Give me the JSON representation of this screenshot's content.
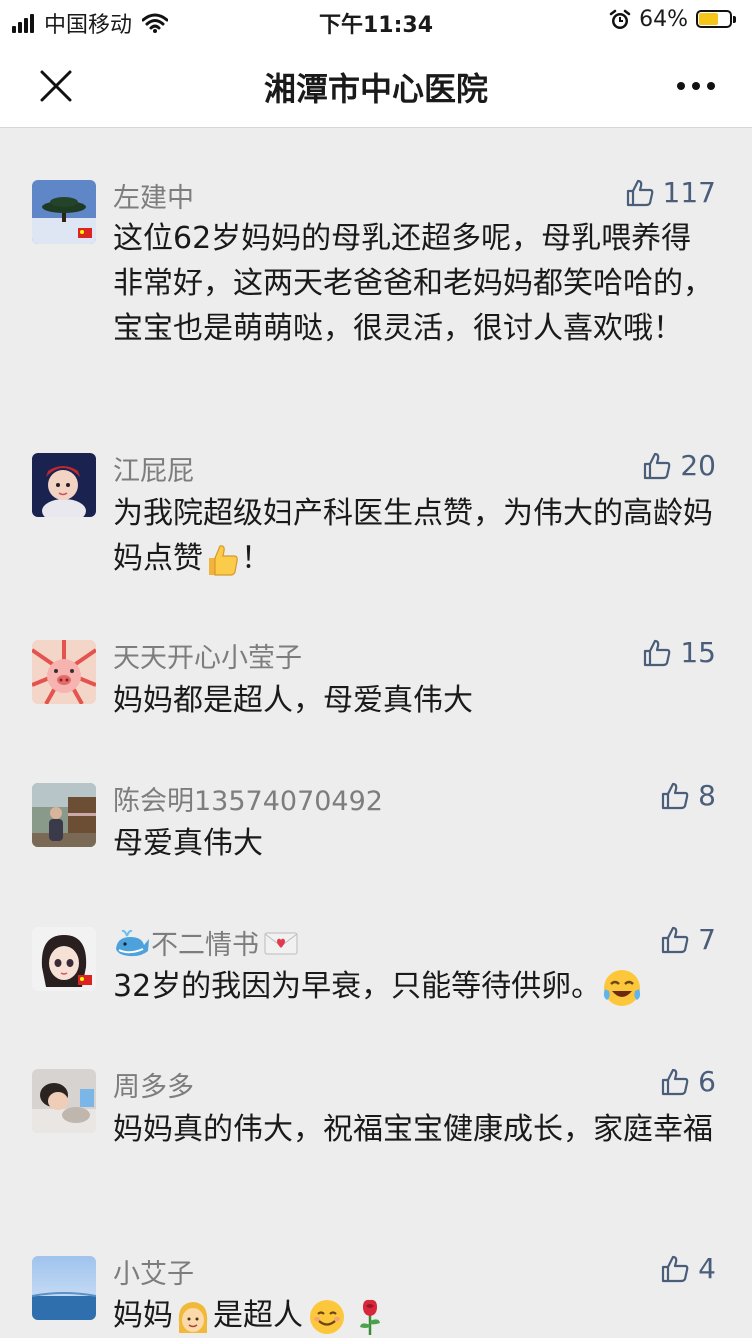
{
  "status_bar": {
    "carrier": "中国移动",
    "time": "下午11:34",
    "battery_percent": "64%",
    "battery_level": 0.64
  },
  "nav": {
    "title": "湘潭市中心医院"
  },
  "comments": [
    {
      "name": "左建中",
      "likes": "117",
      "text": "这位62岁妈妈的母乳还超多呢，母乳喂养得非常好，这两天老爸爸和老妈妈都笑哈哈的，宝宝也是萌萌哒，很灵活，很讨人喜欢哦！"
    },
    {
      "name": "江屁屁",
      "likes": "20",
      "text_a": "为我院超级妇产科医生点赞，为伟大的高龄妈妈点赞",
      "text_b": "！",
      "emoji": "thumbs-up"
    },
    {
      "name": "天天开心小莹子",
      "likes": "15",
      "text": "妈妈都是超人，母爱真伟大"
    },
    {
      "name": "陈会明13574070492",
      "likes": "8",
      "text": "母爱真伟大"
    },
    {
      "name": "不二情书",
      "likes": "7",
      "text": "32岁的我因为早衰，只能等待供卵。",
      "emoji": "crying-laughing"
    },
    {
      "name": "周多多",
      "likes": "6",
      "text": "妈妈真的伟大，祝福宝宝健康成长，家庭幸福"
    },
    {
      "name": "小艾子",
      "likes": "4",
      "text_a": "妈妈",
      "text_b": "是超人",
      "emoji": "woman-smile-rose"
    }
  ]
}
